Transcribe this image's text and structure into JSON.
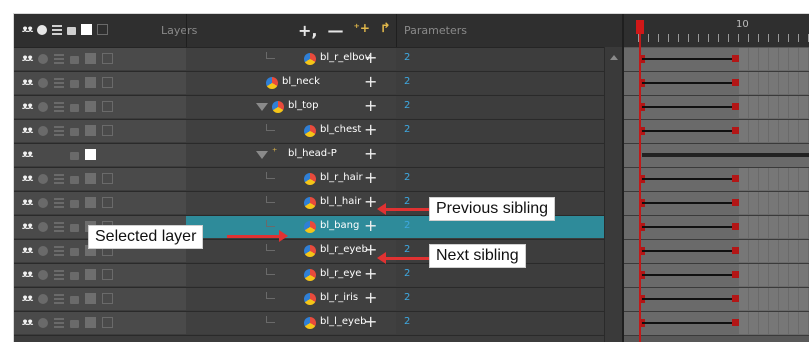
{
  "header": {
    "layers_label": "Layers",
    "parameters_label": "Parameters",
    "timeline_number": "10",
    "tool_add": "+,",
    "tool_remove": "—",
    "tool_add_peg": "⁺+",
    "tool_add_deformer": "↱"
  },
  "layers": [
    {
      "name": "bl_r_elbov",
      "param": "2",
      "indent": 2,
      "type": "drawing",
      "ctl_state": "dim"
    },
    {
      "name": "bl_neck",
      "param": "2",
      "indent": 1,
      "type": "drawing",
      "ctl_state": "dim"
    },
    {
      "name": "bl_top",
      "param": "2",
      "indent": 1,
      "type": "drawing",
      "expanded": true,
      "ctl_state": "dim"
    },
    {
      "name": "bl_chest",
      "param": "2",
      "indent": 2,
      "type": "drawing",
      "ctl_state": "dim"
    },
    {
      "name": "bl_head-P",
      "param": "",
      "indent": 1,
      "type": "peg",
      "expanded": true,
      "ctl_state": "peg"
    },
    {
      "name": "bl_r_hair",
      "param": "2",
      "indent": 2,
      "type": "drawing",
      "ctl_state": "dim"
    },
    {
      "name": "bl_l_hair",
      "param": "2",
      "indent": 2,
      "type": "drawing",
      "ctl_state": "dim"
    },
    {
      "name": "bl_bang",
      "param": "2",
      "indent": 2,
      "type": "drawing",
      "selected": true,
      "ctl_state": "dim"
    },
    {
      "name": "bl_r_eyeb",
      "param": "2",
      "indent": 2,
      "type": "drawing",
      "ctl_state": "dim"
    },
    {
      "name": "bl_r_eye",
      "param": "2",
      "indent": 2,
      "type": "drawing",
      "ctl_state": "dim"
    },
    {
      "name": "bl_r_iris",
      "param": "2",
      "indent": 2,
      "type": "drawing",
      "ctl_state": "dim"
    },
    {
      "name": "bl_l_eyeb",
      "param": "2",
      "indent": 2,
      "type": "drawing",
      "ctl_state": "dim"
    }
  ],
  "callouts": {
    "previous_sibling": "Previous sibling",
    "selected_layer": "Selected layer",
    "next_sibling": "Next sibling"
  },
  "colors": {
    "selected_row": "#2e8b9a",
    "keyframe": "#b31616",
    "playhead": "#d01818",
    "param_value": "#3ea8e0",
    "arrow": "#e03232"
  }
}
